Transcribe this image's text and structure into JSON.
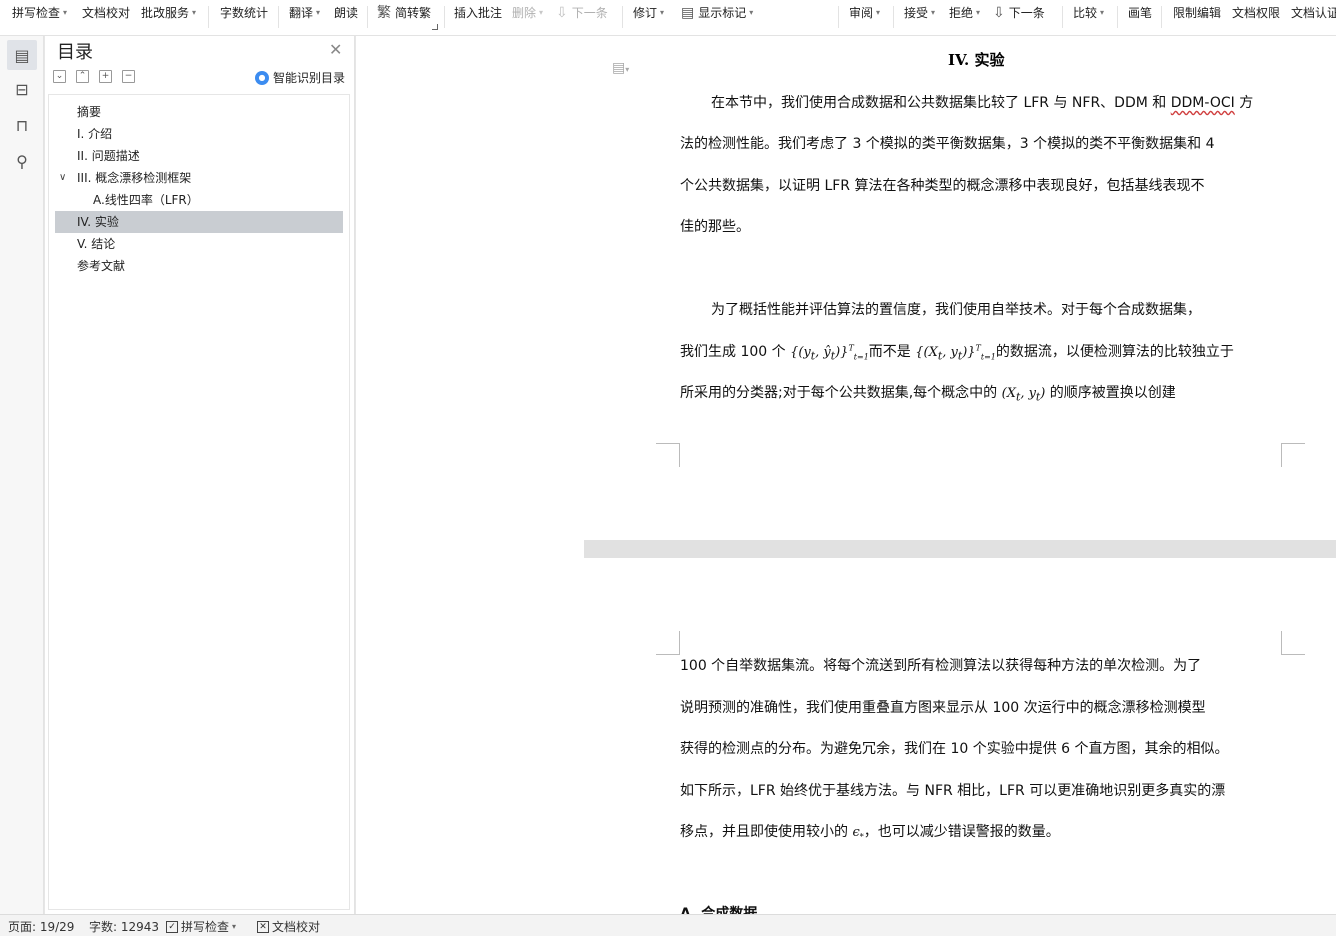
{
  "toolbar": {
    "spell_check": "拼写检查",
    "doc_proof": "文档校对",
    "correction_service": "批改服务",
    "word_count": "字数统计",
    "translate": "翻译",
    "read_aloud": "朗读",
    "simp_trad": "简转繁",
    "insert_comment": "插入批注",
    "delete": "删除",
    "next_item": "下一条",
    "revise": "修订",
    "show_markup": "显示标记",
    "review": "审阅",
    "accept": "接受",
    "reject": "拒绝",
    "next_change": "下一条",
    "compare": "比较",
    "pen": "画笔",
    "restrict_edit": "限制编辑",
    "doc_permission": "文档权限",
    "doc_cert": "文档认证"
  },
  "toc": {
    "title": "目录",
    "smart_label": "智能识别目录",
    "items": [
      {
        "label": "摘要",
        "level": 1,
        "active": false
      },
      {
        "label": "I.  介绍",
        "level": 1,
        "active": false
      },
      {
        "label": "II.  问题描述",
        "level": 1,
        "active": false
      },
      {
        "label": "III.  概念漂移检测框架",
        "level": 1,
        "active": false,
        "expanded": true
      },
      {
        "label": "A.线性四率（LFR）",
        "level": 2,
        "active": false
      },
      {
        "label": "IV.  实验",
        "level": 1,
        "active": true
      },
      {
        "label": "V.  结论",
        "level": 1,
        "active": false
      },
      {
        "label": "参考文献",
        "level": 1,
        "active": false
      }
    ]
  },
  "document": {
    "heading": "IV.  实验",
    "p1_l1": "在本节中，我们使用合成数据和公共数据集比较了 LFR 与 NFR、DDM 和 ",
    "p1_l1_tail": "DDM-OCI",
    "p1_l1_end": " 方",
    "p1_l2": "法的检测性能。我们考虑了 3 个模拟的类平衡数据集，3 个模拟的类不平衡数据集和 4",
    "p1_l3": "个公共数据集，以证明 LFR 算法在各种类型的概念漂移中表现良好，包括基线表现不",
    "p1_l4": "佳的那些。",
    "p2_l1": "为了概括性能并评估算法的置信度，我们使用自举技术。对于每个合成数据集，",
    "p2_l2_a": "我们生成 100 个 ",
    "p2_l2_m1": "{(y",
    "p2_l2_m1b": "t",
    "p2_l2_m1c": ", ŷ",
    "p2_l2_m1d": ")}",
    "p2_l2_sup": "T",
    "p2_l2_sub": "t=1",
    "p2_l2_b": "而不是 ",
    "p2_l2_m2": "{(X",
    "p2_l2_m2c": ", y",
    "p2_l2_m2d": ")}",
    "p2_l2_c": "的数据流，以便检测算法的比较独立于",
    "p2_l3_a": "所采用的分类器;对于每个公共数据集,每个概念中的 ",
    "p2_l3_m": "(X",
    "p2_l3_mc": ", y",
    "p2_l3_md": ")",
    "p2_l3_b": " 的顺序被置换以创建",
    "p3_l1": "100 个自举数据集流。将每个流送到所有检测算法以获得每种方法的单次检测。为了",
    "p3_l2": "说明预测的准确性，我们使用重叠直方图来显示从 100 次运行中的概念漂移检测模型",
    "p3_l3": "获得的检测点的分布。为避免冗余，我们在 10 个实验中提供 6 个直方图，其余的相似。",
    "p3_l4": "如下所示，LFR 始终优于基线方法。与 NFR 相比，LFR 可以更准确地识别更多真实的漂",
    "p3_l5_a": "移点，并且即使使用较小的 ",
    "p3_l5_m": "ϵ",
    "p3_l5_msub": "*",
    "p3_l5_b": "，也可以减少错误警报的数量。",
    "p4_heading": "A.  合成数据"
  },
  "status": {
    "page": "页面: 19/29",
    "words": "字数: 12943",
    "spell": "拼写检查",
    "proof": "文档校对"
  }
}
